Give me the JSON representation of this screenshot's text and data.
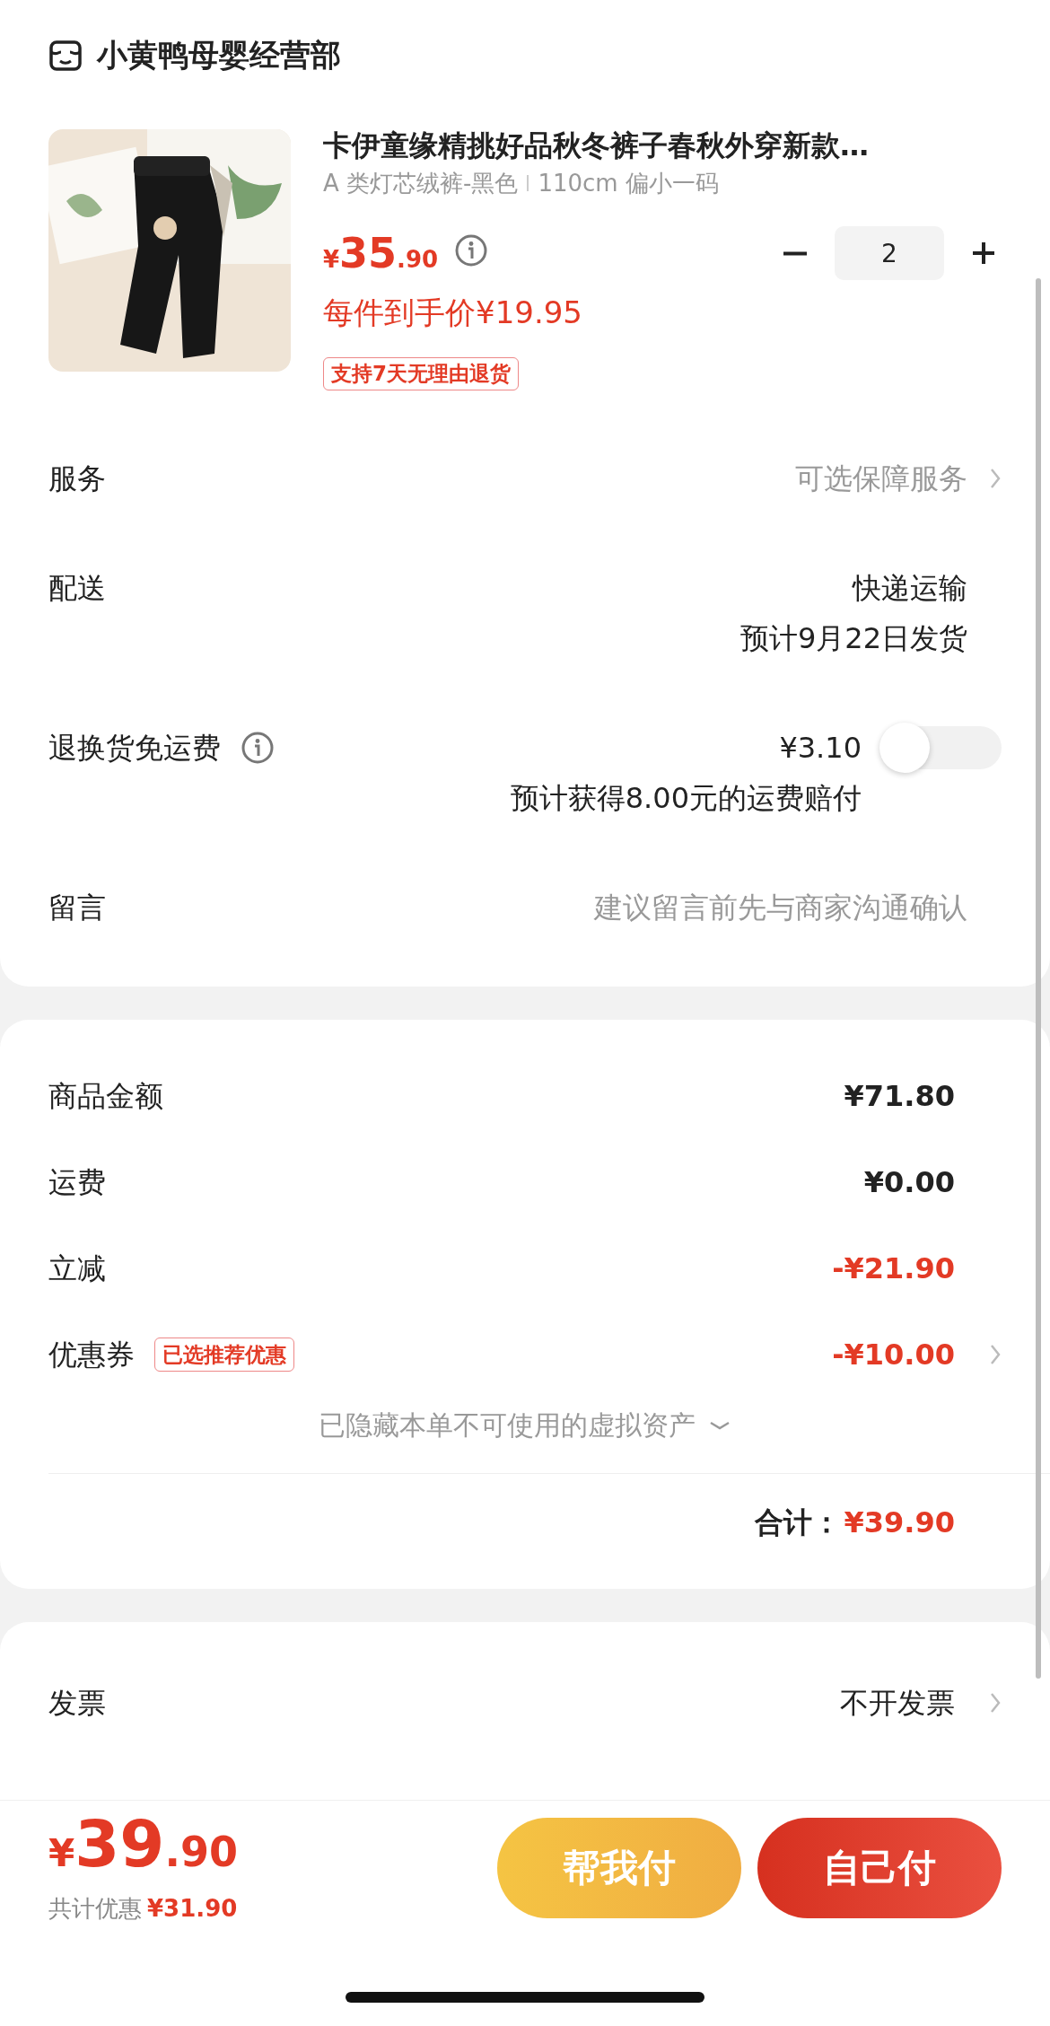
{
  "store": {
    "name": "小黄鸭母婴经营部"
  },
  "product": {
    "title": "卡伊童缘精挑好品秋冬裤子春秋外穿新款…",
    "spec": "A 类灯芯绒裤-黑色",
    "size": "110cm 偏小一码",
    "price_symbol": "¥",
    "price_int": "35",
    "price_dec": ".90",
    "unit_price": "每件到手价¥19.95",
    "tag": "支持7天无理由退货",
    "quantity": "2"
  },
  "services": [
    {
      "kind": "link",
      "label": "服务",
      "value": "可选保障服务"
    },
    {
      "kind": "lines",
      "label": "配送",
      "lines": [
        "快递运输",
        "预计9月22日发货"
      ]
    },
    {
      "kind": "toggle",
      "label": "退换货免运费",
      "lines": [
        "¥3.10",
        "预计获得8.00元的运费赔付"
      ],
      "on": false
    },
    {
      "kind": "input",
      "label": "留言",
      "placeholder": "建议留言前先与商家沟通确认"
    }
  ],
  "summary": {
    "rows": [
      {
        "kind": "plain",
        "label": "商品金额",
        "value": "¥71.80"
      },
      {
        "kind": "plain",
        "label": "运费",
        "value": "¥0.00"
      },
      {
        "kind": "discount",
        "label": "立减",
        "value": "-¥21.90"
      },
      {
        "kind": "coupon",
        "label": "优惠券",
        "badge": "已选推荐优惠",
        "value": "-¥10.00"
      }
    ],
    "hidden_note": "已隐藏本单不可使用的虚拟资产",
    "total_label": "合计：",
    "total": "¥39.90"
  },
  "invoice": {
    "label": "发票",
    "value": "不开发票"
  },
  "bottom_bar": {
    "price_symbol": "¥",
    "price_int": "39",
    "price_dec": ".90",
    "savings_label": "共计优惠",
    "savings": "¥31.90",
    "buttons": [
      {
        "kind": "secondary",
        "label": "帮我付"
      },
      {
        "kind": "primary",
        "label": "自己付"
      }
    ]
  }
}
